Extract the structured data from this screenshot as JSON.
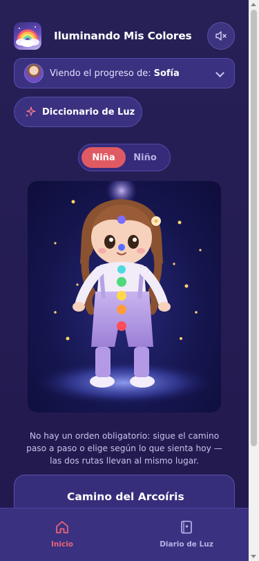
{
  "header": {
    "title": "Iluminando Mis Colores",
    "logo_icon": "rainbow-cloud-logo",
    "mute_icon": "speaker-muted-icon"
  },
  "progress_selector": {
    "label": "Viendo el progreso de:",
    "selected_child": "Sofía"
  },
  "dictionary_button": {
    "label": "Diccionario de Luz",
    "icon": "sparkles-icon"
  },
  "gender_toggle": {
    "options": [
      "Niña",
      "Niño"
    ],
    "selected": "Niña"
  },
  "caption": "No hay un orden obligatorio: sigue el camino paso a paso o elige según lo que sienta hoy — las dos rutas llevan al mismo lugar.",
  "path_card": {
    "title": "Camino del Arcoíris",
    "icon": "rainbow-icon"
  },
  "bottom_nav": {
    "items": [
      {
        "label": "Inicio",
        "icon": "home-icon",
        "active": true
      },
      {
        "label": "Diario de Luz",
        "icon": "journal-icon",
        "active": false
      }
    ]
  },
  "colors": {
    "accent": "#e05a63",
    "nav_active": "#e9657a",
    "background": "#241c52",
    "panel": "#3a3180"
  }
}
